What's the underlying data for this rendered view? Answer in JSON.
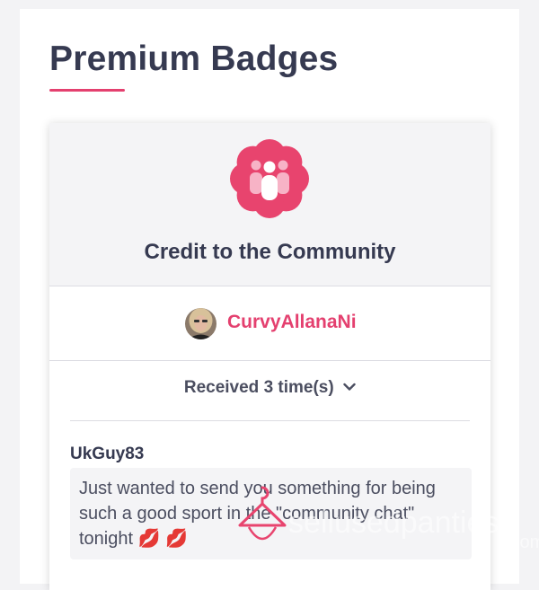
{
  "page": {
    "title": "Premium Badges"
  },
  "badge": {
    "name": "Credit to the Community",
    "icon": "community-people-icon",
    "color": "#e8446e"
  },
  "owner": {
    "username": "CurvyAllanaNi",
    "avatar": "user-avatar"
  },
  "received": {
    "label": "Received 3 time(s)",
    "icon": "chevron-down-icon"
  },
  "gift": {
    "sender": "UkGuy83",
    "message": "Just wanted to send you something for being such a good sport in the \"community chat\" tonight 💋 💋"
  },
  "watermark": {
    "text": "sellusedpanties.com",
    "icon": "hanger-logo-icon"
  },
  "colors": {
    "accent": "#e4406f",
    "heading": "#363a51",
    "body": "#4b4e60",
    "panel": "#f4f4f6"
  }
}
